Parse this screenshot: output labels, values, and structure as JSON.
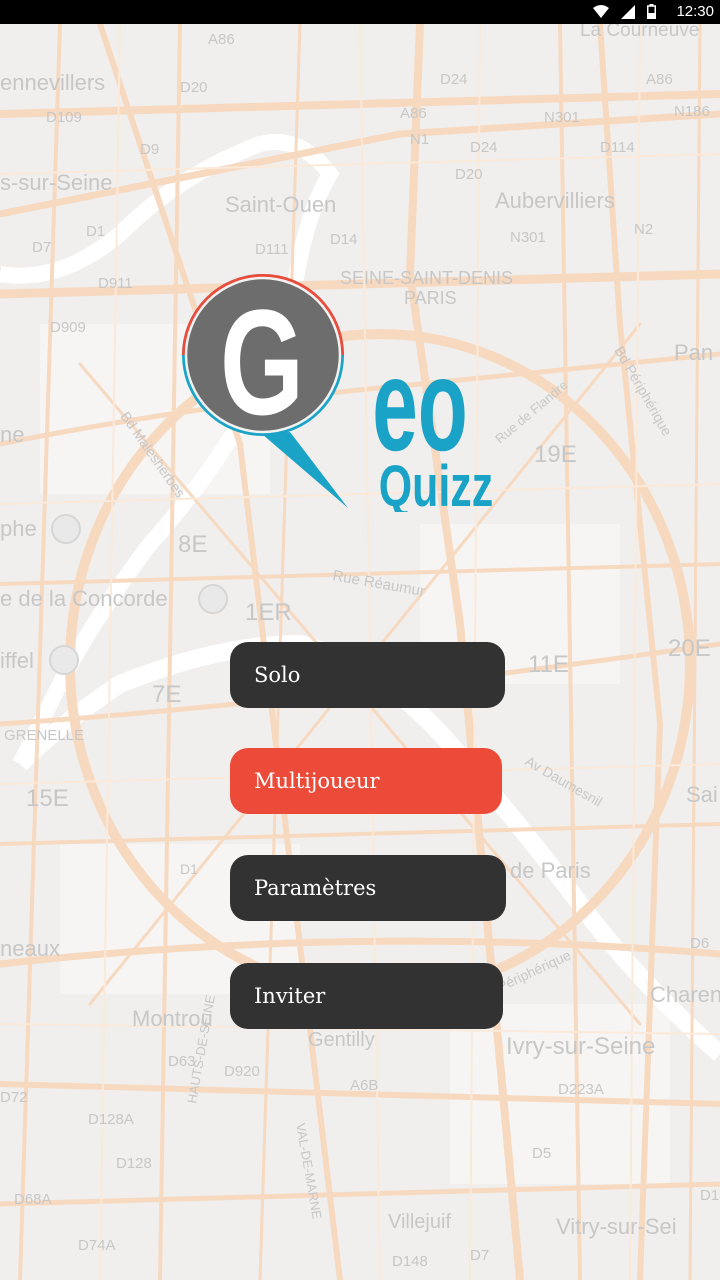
{
  "status_bar": {
    "time": "12:30",
    "icons": [
      "wifi-icon",
      "signal-icon",
      "battery-icon"
    ]
  },
  "map": {
    "labels": [
      "A86",
      "La Courneuve",
      "ennevillers",
      "D20",
      "D24",
      "A86",
      "D109",
      "A86",
      "N301",
      "N186",
      "D9",
      "N1",
      "D24",
      "D114",
      "s-sur-Seine",
      "D20",
      "Saint-Ouen",
      "Aubervilliers",
      "D1",
      "D7",
      "D111",
      "D14",
      "N301",
      "N2",
      "D911",
      "SEINE-SAINT-DENIS",
      "PARIS",
      "Pan",
      "D909",
      "Bd Périphérique",
      "19E",
      "ne",
      "Bd Malesherbes",
      "8E",
      "phe",
      "e de la Concorde",
      "Rue Réaumur",
      "1ER",
      "20E",
      "iffel",
      "11E",
      "7E",
      "GRENELLE",
      "Av Daumesnil",
      "15E",
      "Sai",
      "de Paris",
      "D6",
      "neaux",
      "Périphérique",
      "Charen",
      "Montrou",
      "Gentilly",
      "Ivry-sur-Seine",
      "D63",
      "D920",
      "A6B",
      "D223A",
      "D72",
      "D128A",
      "D5",
      "D128",
      "HAUTS-DE-SEINE",
      "VAL-DE-MARNE",
      "D68A",
      "Villejuif",
      "Vitry-sur-Sei",
      "D74A",
      "D148",
      "D7",
      "D1",
      "D18",
      "Rue de Flandre"
    ]
  },
  "logo": {
    "letter": "G",
    "word": "eo",
    "subtitle": "Quizz",
    "colors": {
      "gray": "#6d6d6d",
      "blue": "#1aa3c6",
      "red": "#ed4b3a"
    }
  },
  "menu": {
    "solo": "Solo",
    "multiplayer": "Multijoueur",
    "settings": "Paramètres",
    "invite": "Inviter"
  },
  "colors": {
    "button_dark": "#323232",
    "button_accent": "#ed4b3a"
  }
}
